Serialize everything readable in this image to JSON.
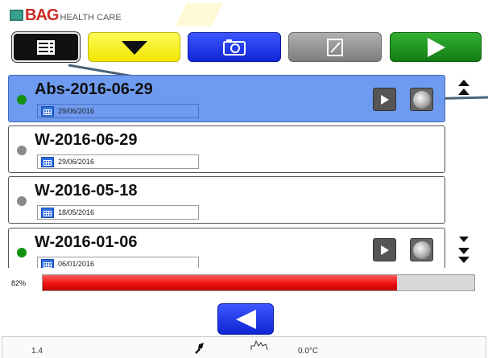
{
  "header": {
    "brand": "BAG",
    "brand_sub": "HEALTH CARE"
  },
  "toolbar": {
    "buttons": [
      {
        "name": "menu",
        "icon": "list-menu-icon",
        "color": "#111111"
      },
      {
        "name": "down",
        "icon": "triangle-down-icon",
        "color": "#f7ee00"
      },
      {
        "name": "camera",
        "icon": "camera-icon",
        "color": "#1a33f0"
      },
      {
        "name": "edit",
        "icon": "edit-note-icon",
        "color": "#8e8e8e"
      },
      {
        "name": "play",
        "icon": "play-icon",
        "color": "#1f9a1f"
      }
    ]
  },
  "list": {
    "items": [
      {
        "name": "Abs-2016-06-29",
        "date": "29/06/2016",
        "status": "green",
        "selected": true,
        "has_actions": true
      },
      {
        "name": "W-2016-06-29",
        "date": "29/06/2016",
        "status": "grey",
        "selected": false,
        "has_actions": false
      },
      {
        "name": "W-2016-05-18",
        "date": "18/05/2016",
        "status": "grey",
        "selected": false,
        "has_actions": false
      },
      {
        "name": "W-2016-01-06",
        "date": "06/01/2016",
        "status": "green",
        "selected": false,
        "has_actions": true
      }
    ]
  },
  "progress": {
    "label": "82%",
    "value": 0.82
  },
  "status_bar": {
    "left_value": "1.4",
    "temperature": "0.0°C"
  },
  "colors": {
    "selected_row": "#6e9bf0",
    "progress_fill": "#ee1111",
    "status_active": "#139113",
    "status_inactive": "#8a8a8a"
  }
}
